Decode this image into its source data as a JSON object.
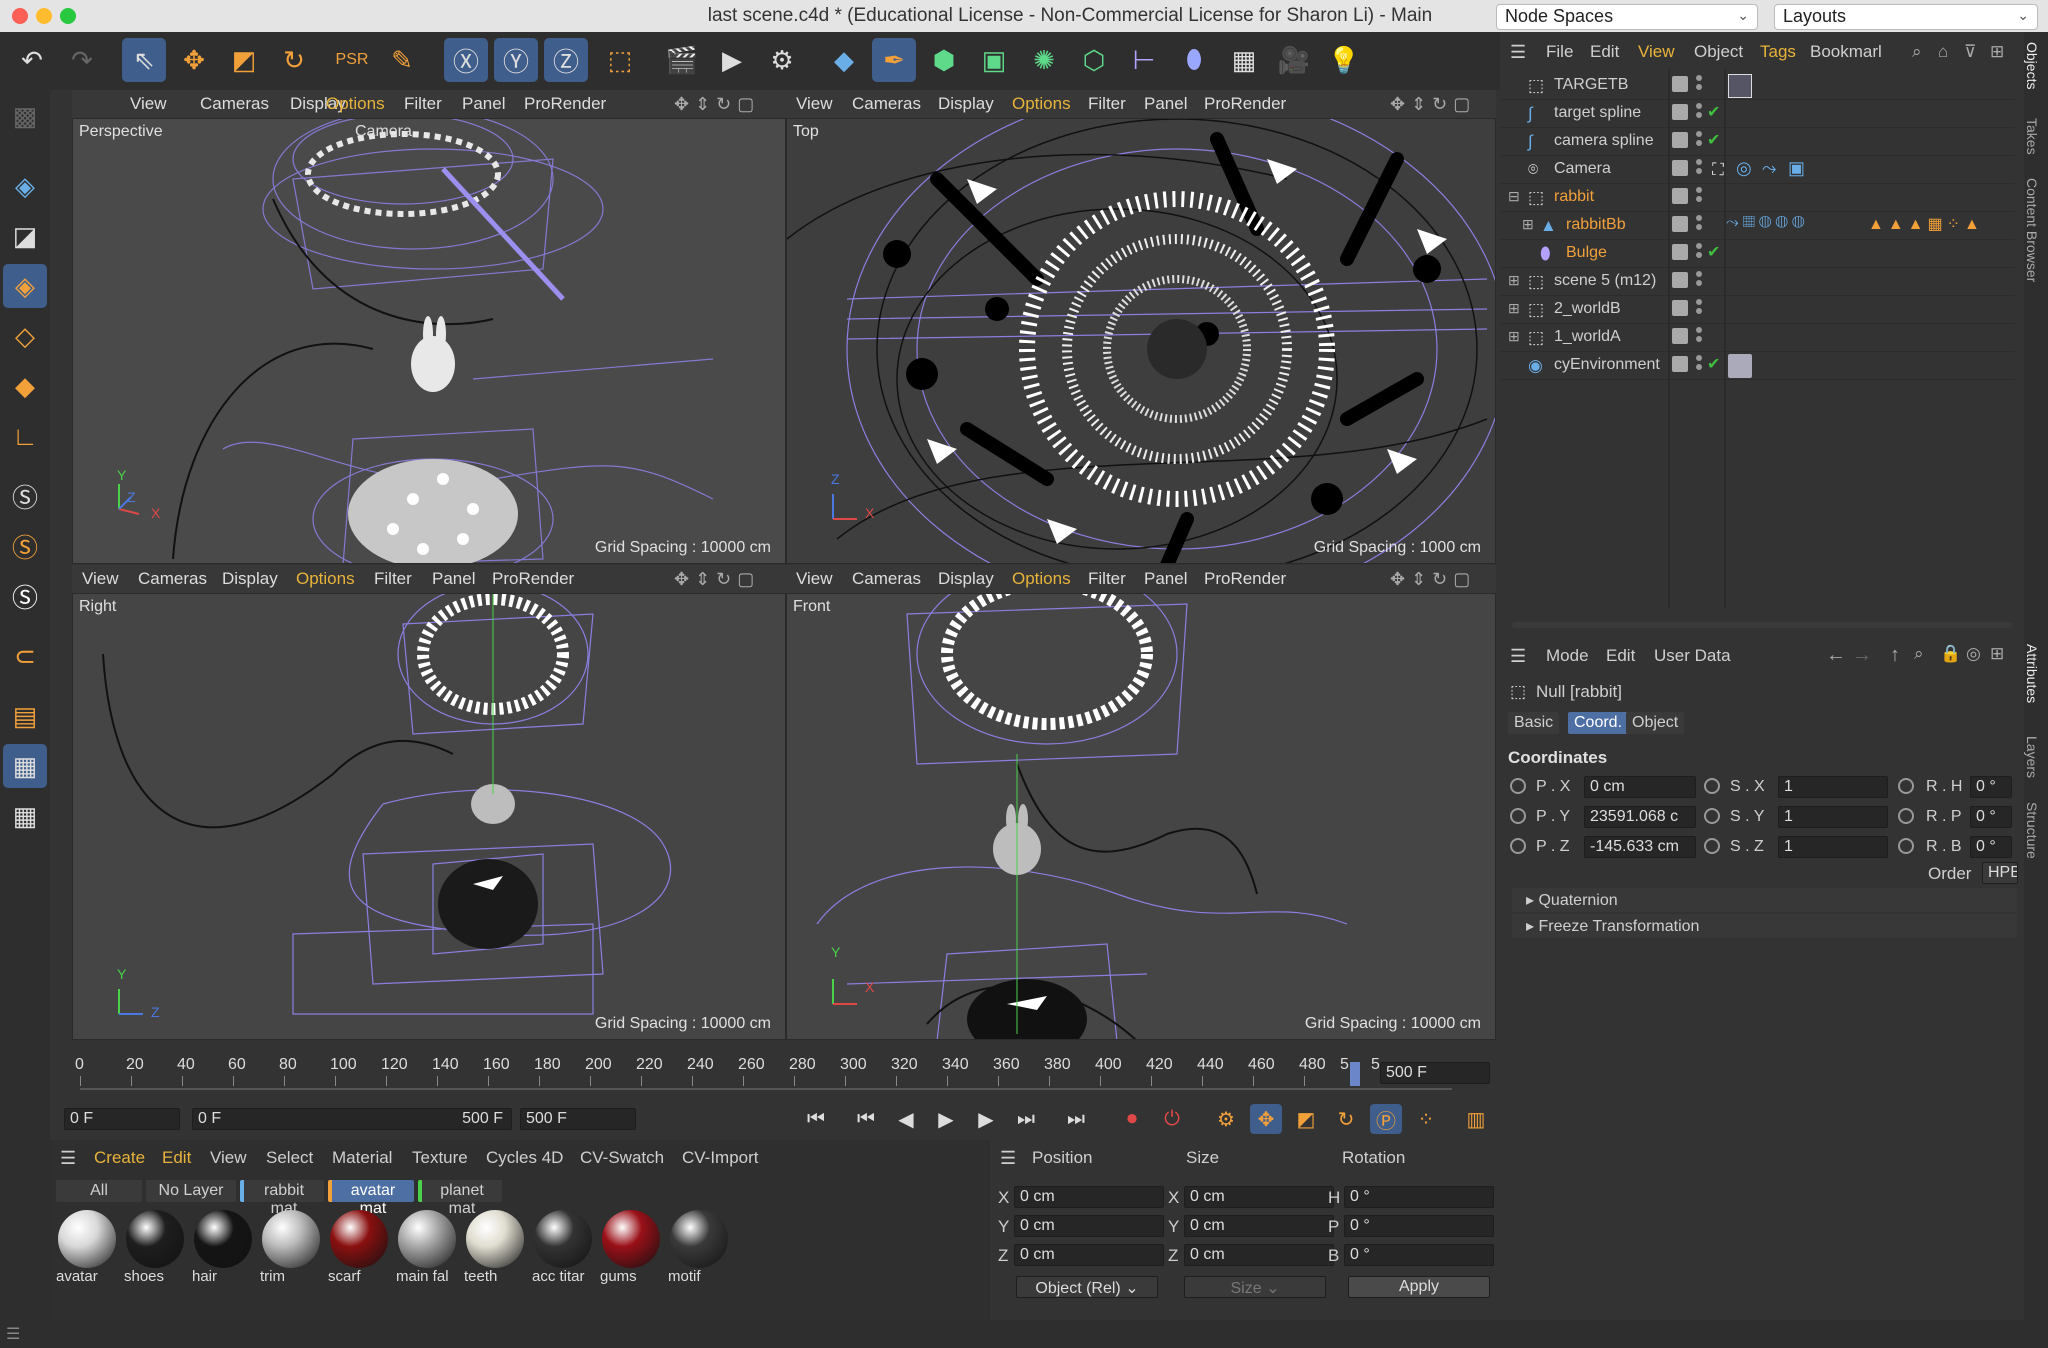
{
  "window": {
    "title": "last scene.c4d * (Educational License - Non-Commercial License for Sharon Li) - Main",
    "node_spaces": "Node Spaces",
    "layouts": "Layouts"
  },
  "viewport_menu": [
    "View",
    "Cameras",
    "Display",
    "Options",
    "Filter",
    "Panel",
    "ProRender"
  ],
  "viewports": [
    {
      "label": "Perspective",
      "camera": "Camera",
      "grid": "Grid Spacing : 10000 cm",
      "axes": [
        "Y",
        "Z",
        "X"
      ]
    },
    {
      "label": "Top",
      "grid": "Grid Spacing : 1000 cm",
      "axes": [
        "Z",
        "X"
      ]
    },
    {
      "label": "Right",
      "grid": "Grid Spacing : 10000 cm",
      "axes": [
        "Y",
        "Z"
      ]
    },
    {
      "label": "Front",
      "grid": "Grid Spacing : 10000 cm",
      "axes": [
        "Y",
        "X"
      ]
    }
  ],
  "object_manager": {
    "menu": [
      "File",
      "Edit",
      "View",
      "Object",
      "Tags",
      "Bookmarl"
    ],
    "objects": [
      {
        "name": "TARGETB",
        "icon": "null-icon",
        "color": "#ffffff"
      },
      {
        "name": "target spline",
        "icon": "spline-icon",
        "color": "#ffffff"
      },
      {
        "name": "camera spline",
        "icon": "spline-icon",
        "color": "#ffffff"
      },
      {
        "name": "Camera",
        "icon": "camera-icon",
        "color": "#ffffff"
      },
      {
        "name": "rabbit",
        "icon": "null-icon",
        "color": "#f2a03a"
      },
      {
        "name": "rabbitBb",
        "icon": "polygon-icon",
        "color": "#f2a03a"
      },
      {
        "name": "Bulge",
        "icon": "deformer-icon",
        "color": "#f2a03a"
      },
      {
        "name": "scene 5 (m12)",
        "icon": "null-icon",
        "color": "#ffffff"
      },
      {
        "name": "2_worldB",
        "icon": "null-icon",
        "color": "#ffffff"
      },
      {
        "name": "1_worldA",
        "icon": "null-icon",
        "color": "#ffffff"
      },
      {
        "name": "cyEnvironment",
        "icon": "environment-icon",
        "color": "#ffffff"
      }
    ]
  },
  "attributes": {
    "menu": [
      "Mode",
      "Edit",
      "User Data"
    ],
    "object_title": "Null [rabbit]",
    "tabs": [
      "Basic",
      "Coord.",
      "Object"
    ],
    "active_tab": "Coord.",
    "section": "Coordinates",
    "rows": [
      {
        "p_label": "P . X",
        "p_value": "0 cm",
        "s_label": "S . X",
        "s_value": "1",
        "r_label": "R . H",
        "r_value": "0 °"
      },
      {
        "p_label": "P . Y",
        "p_value": "23591.068 c",
        "s_label": "S . Y",
        "s_value": "1",
        "r_label": "R . P",
        "r_value": "0 °"
      },
      {
        "p_label": "P . Z",
        "p_value": "-145.633 cm",
        "s_label": "S . Z",
        "s_value": "1",
        "r_label": "R . B",
        "r_value": "0 °"
      }
    ],
    "order_label": "Order",
    "order_value": "HPB",
    "collapsed": [
      "Quaternion",
      "Freeze Transformation"
    ]
  },
  "side_tabs": [
    "Objects",
    "Takes",
    "Content Browser",
    "Attributes",
    "Layers",
    "Structure"
  ],
  "timeline": {
    "ticks": [
      "0",
      "20",
      "40",
      "60",
      "80",
      "100",
      "120",
      "140",
      "160",
      "180",
      "200",
      "220",
      "240",
      "260",
      "280",
      "300",
      "320",
      "340",
      "360",
      "380",
      "400",
      "420",
      "440",
      "460",
      "480",
      "5",
      "5"
    ],
    "end_field": "500 F",
    "current_frame": "0 F",
    "range_start": "0 F",
    "range_end": "500 F",
    "max_frame": "500 F"
  },
  "material_manager": {
    "menu": [
      "Create",
      "Edit",
      "View",
      "Select",
      "Material",
      "Texture",
      "Cycles 4D",
      "CV-Swatch",
      "CV-Import"
    ],
    "layer_tabs": [
      "All",
      "No Layer",
      "rabbit mat",
      "avatar mat",
      "planet mat"
    ],
    "active_layer": "avatar mat",
    "materials": [
      {
        "name": "avatar",
        "color": "#d8d8d8"
      },
      {
        "name": "shoes",
        "color": "#1e1e1e"
      },
      {
        "name": "hair",
        "color": "#151515"
      },
      {
        "name": "trim",
        "color": "#bbbbbb"
      },
      {
        "name": "scarf",
        "color": "#8a1010"
      },
      {
        "name": "main fal",
        "color": "#a8a8a8"
      },
      {
        "name": "teeth",
        "color": "#e0ddd0"
      },
      {
        "name": "acc titar",
        "color": "#333333"
      },
      {
        "name": "gums",
        "color": "#9a1018"
      },
      {
        "name": "motif",
        "color": "#3a3a3a"
      }
    ]
  },
  "coord_manager": {
    "headers": [
      "Position",
      "Size",
      "Rotation"
    ],
    "rows": [
      {
        "p_axis": "X",
        "p": "0 cm",
        "s_axis": "X",
        "s": "0 cm",
        "r_axis": "H",
        "r": "0 °"
      },
      {
        "p_axis": "Y",
        "p": "0 cm",
        "s_axis": "Y",
        "s": "0 cm",
        "r_axis": "P",
        "r": "0 °"
      },
      {
        "p_axis": "Z",
        "p": "0 cm",
        "s_axis": "Z",
        "s": "0 cm",
        "r_axis": "B",
        "r": "0 °"
      }
    ],
    "mode_select": "Object (Rel)",
    "size_select": "Size",
    "apply": "Apply"
  },
  "colors": {
    "accent": "#4e6fa3",
    "options_menu": "#e8b33a",
    "wire": "#8a7fe0"
  }
}
